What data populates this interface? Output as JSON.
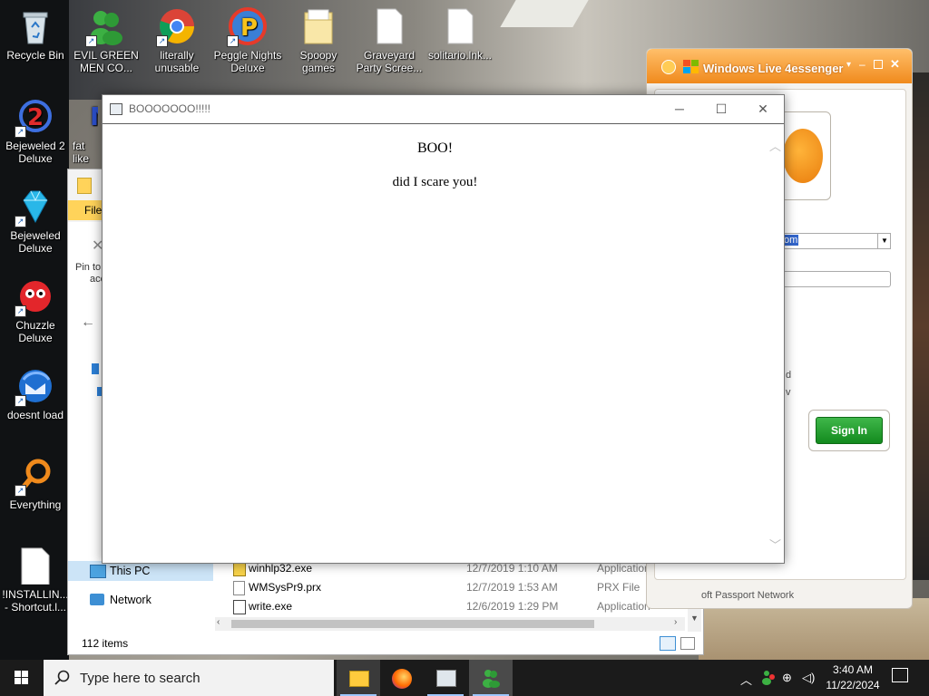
{
  "desktop": {
    "icons": [
      {
        "label": "Recycle Bin"
      },
      {
        "label": "EVIL GREEN MEN CO..."
      },
      {
        "label": "literally unusable"
      },
      {
        "label": "Peggle Nights Deluxe"
      },
      {
        "label": "Spoopy games"
      },
      {
        "label": "Graveyard Party Scree..."
      },
      {
        "label": "solitario.lnk..."
      },
      {
        "label": "Bejeweled 2 Deluxe"
      },
      {
        "label": "fat like"
      },
      {
        "label": "Bejeweled Deluxe"
      },
      {
        "label": "Chuzzle Deluxe"
      },
      {
        "label": "doesnt load"
      },
      {
        "label": "Everything"
      },
      {
        "label": "!INSTALLIN... - Shortcut.l..."
      }
    ]
  },
  "explorer": {
    "file_tab": "File",
    "pin_text": "Pin to",
    "pin_text2": "acc",
    "sidebar": [
      {
        "label": "This PC"
      },
      {
        "label": "Network"
      }
    ],
    "rows": [
      {
        "name": "winhlp32.exe",
        "date": "12/7/2019 1:10 AM",
        "type": "Application"
      },
      {
        "name": "WMSysPr9.prx",
        "date": "12/7/2019 1:53 AM",
        "type": "PRX File"
      },
      {
        "name": "write.exe",
        "date": "12/6/2019 1:29 PM",
        "type": "Application"
      }
    ],
    "status": "112 items"
  },
  "messenger": {
    "title": "Windows Live 4essenger",
    "email_fragment": "om",
    "sign_in_label": "Sign In",
    "footer": "oft Passport Network",
    "side_fragment_1": "d",
    "side_fragment_2": "v"
  },
  "popup": {
    "title": "BOOOOOOO!!!!!",
    "heading": "BOO!",
    "message": "did I scare you!"
  },
  "taskbar": {
    "search_placeholder": "Type here to search",
    "time": "3:40 AM",
    "date": "11/22/2024"
  },
  "colors": {
    "messenger_orange": "#f08a1c",
    "signin_green": "#1e9b2a",
    "taskbar": "#1b1b1b",
    "file_tab_yellow": "#ffd35a"
  }
}
